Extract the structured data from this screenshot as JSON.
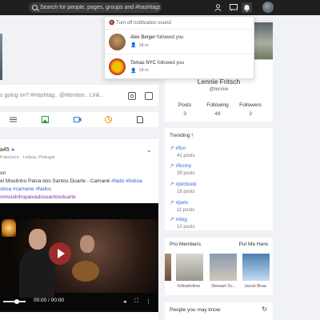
{
  "topbar": {
    "search_placeholder": "Search for people, pages, groups and #hashtags"
  },
  "notifications": {
    "header": "Turn off notification sound",
    "items": [
      {
        "name": "Alex Berger",
        "action": "followed you",
        "time": "18 m"
      },
      {
        "name": "Tomas NYC",
        "action": "followed you",
        "time": "18 m"
      }
    ]
  },
  "composer": {
    "placeholder": "s going on? #Hashtag.. @Mention.. Link.."
  },
  "post": {
    "author": "a45",
    "location": "Francisco · Lisboa, Portugal",
    "body_lines": [
      {
        "text": "on",
        "tags": ""
      },
      {
        "text": "el Moulinho Paiva dos Santos Duarte - Camané ",
        "tags": "#fado #lisboa"
      },
      {
        "text": "",
        "tags": "sboa #camane #fados"
      },
      {
        "text": "",
        "tags": "vimoulinhopaivadossantosduarte"
      }
    ],
    "video_time": "00:00 / 00:00"
  },
  "profile": {
    "name": "Lennie Fritsch",
    "handle": "@lennie",
    "stats": [
      {
        "label": "Posts",
        "value": "3"
      },
      {
        "label": "Following",
        "value": "48"
      },
      {
        "label": "Followers",
        "value": "3"
      }
    ]
  },
  "trending": {
    "title": "Trending !",
    "items": [
      {
        "tag": "#fun",
        "count": "41 posts"
      },
      {
        "tag": "#funny",
        "count": "39 posts"
      },
      {
        "tag": "#picbook",
        "count": "18 posts"
      },
      {
        "tag": "#pets",
        "count": "11 posts"
      },
      {
        "tag": "#dog",
        "count": "10 posts"
      }
    ]
  },
  "pro_members": {
    "title": "Pro Members",
    "more": "Put Me Here",
    "members": [
      "",
      "followfollow",
      "Stewart Sc...",
      "Jacob Braa"
    ]
  },
  "people": {
    "title": "People you may know"
  }
}
